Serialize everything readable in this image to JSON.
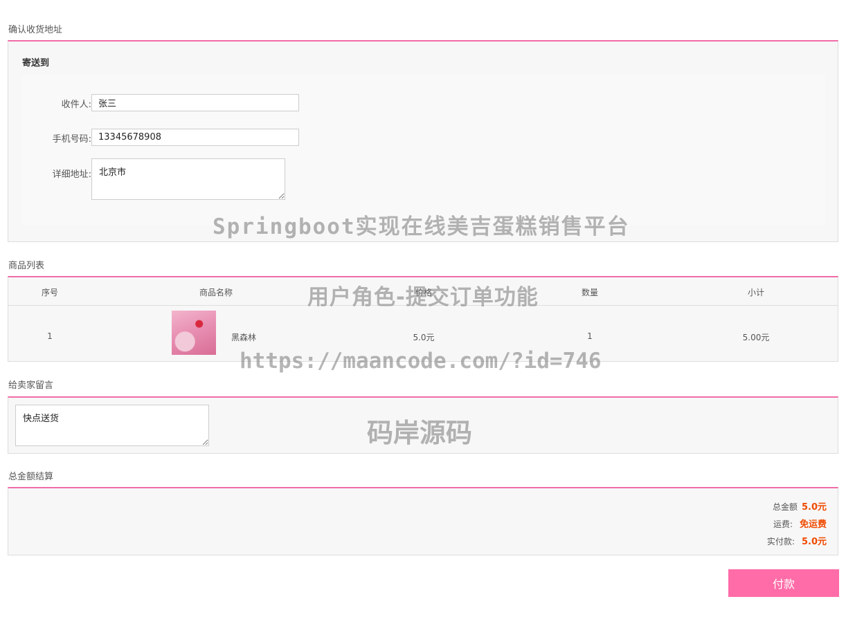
{
  "address_section": {
    "title": "确认收货地址",
    "ship_to_title": "寄送到",
    "receiver": {
      "label": "收件人:",
      "value": "张三"
    },
    "phone": {
      "label": "手机号码:",
      "value": "13345678908"
    },
    "address": {
      "label": "详细地址:",
      "value": "北京市"
    }
  },
  "product_section": {
    "title": "商品列表",
    "columns": [
      "序号",
      "商品名称",
      "价格",
      "数量",
      "小计"
    ],
    "rows": [
      {
        "index": "1",
        "name": "黑森林",
        "price": "5.0元",
        "quantity": "1",
        "subtotal": "5.00元"
      }
    ]
  },
  "message_section": {
    "title": "给卖家留言",
    "value": "快点送货"
  },
  "total_section": {
    "title": "总金额结算",
    "total_label": "总金额",
    "total_value": "5.0元",
    "shipping_label": "运费:",
    "shipping_value": "免运费",
    "paid_label": "实付款:",
    "paid_value": "5.0元"
  },
  "pay_button_label": "付款",
  "watermarks": [
    "Springboot实现在线美吉蛋糕销售平台",
    "用户角色-提交订单功能",
    "https://maancode.com/?id=746",
    "码岸源码"
  ],
  "colors": {
    "accent_line": "#f06ca7",
    "pay_button": "#ff6ca8",
    "price_highlight": "#f04a00"
  }
}
